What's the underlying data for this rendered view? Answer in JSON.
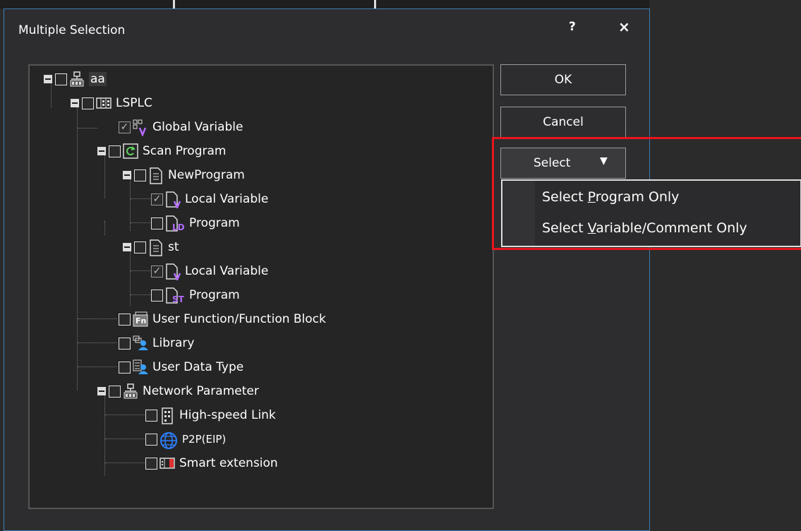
{
  "dialog": {
    "title": "Multiple Selection",
    "help": "?",
    "close": "×"
  },
  "buttons": {
    "ok": "OK",
    "cancel": "Cancel",
    "select": "Select",
    "select_arrow": "▼"
  },
  "menu": {
    "item1_pre": "Select ",
    "item1_u": "P",
    "item1_post": "rogram Only",
    "item2_pre": "Select ",
    "item2_u": "V",
    "item2_post": "ariable/Comment Only"
  },
  "tree": {
    "root": "aa",
    "plc": "LSPLC",
    "global_variable": "Global Variable",
    "scan_program": "Scan Program",
    "new_program": "NewProgram",
    "np_local_variable": "Local Variable",
    "np_program": "Program",
    "st": "st",
    "st_local_variable": "Local Variable",
    "st_program": "Program",
    "user_function": "User Function/Function Block",
    "library": "Library",
    "user_data_type": "User Data Type",
    "network_parameter": "Network Parameter",
    "high_speed_link": "High-speed Link",
    "p2p": "P2P(EIP)",
    "smart_extension": "Smart extension"
  },
  "icons": {
    "ld_tag": "LD",
    "st_tag": "ST",
    "fn_tag": "Fn",
    "v_tag": "V"
  },
  "colors": {
    "accent_border": "#3c7fb1",
    "highlight": "#e8151c",
    "purple": "#b36bff",
    "library_blue": "#3aa0ff"
  }
}
